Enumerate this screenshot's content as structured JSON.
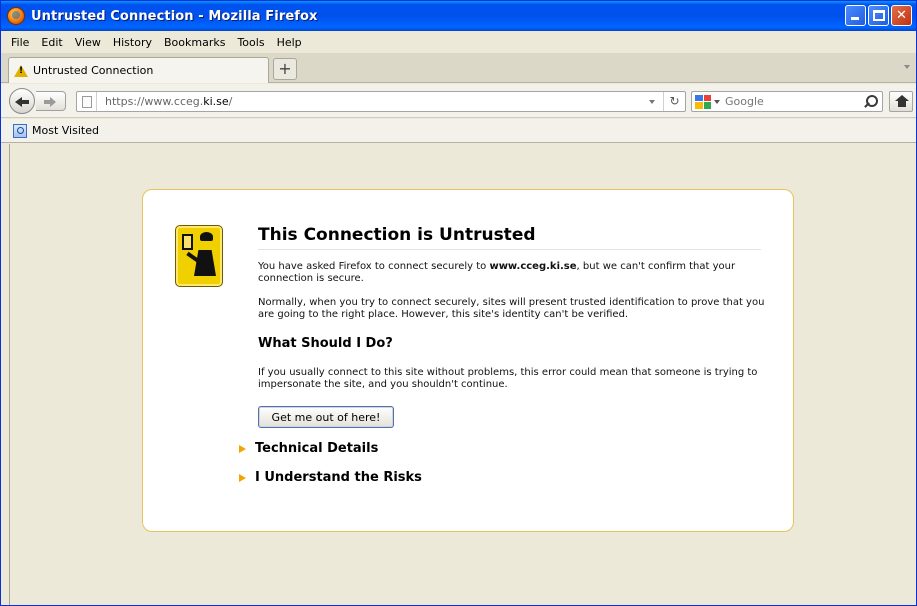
{
  "window": {
    "title": "Untrusted Connection - Mozilla Firefox"
  },
  "menu": [
    "File",
    "Edit",
    "View",
    "History",
    "Bookmarks",
    "Tools",
    "Help"
  ],
  "tab": {
    "label": "Untrusted Connection"
  },
  "nav": {
    "url_prefix": "https://www.cceg.",
    "url_domain": "ki.se",
    "url_suffix": "/",
    "search_placeholder": "Google"
  },
  "bookmarks": {
    "most_visited": "Most Visited"
  },
  "error": {
    "title": "This Connection is Untrusted",
    "p1_before": "You have asked Firefox to connect securely to ",
    "p1_host": "www.cceg.ki.se",
    "p1_after": ", but we can't confirm that your connection is secure.",
    "p2": "Normally, when you try to connect securely, sites will present trusted identification to prove that you are going to the right place. However, this site's identity can't be verified.",
    "what_title": "What Should I Do?",
    "p3": "If you usually connect to this site without problems, this error could mean that someone is trying to impersonate the site, and you shouldn't continue.",
    "button": "Get me out of here!",
    "technical": "Technical Details",
    "risks": "I Understand the Risks"
  },
  "colors": {
    "titlebar": "#0053ee",
    "box_border": "#e8c35f",
    "expander": "#f0a500"
  }
}
